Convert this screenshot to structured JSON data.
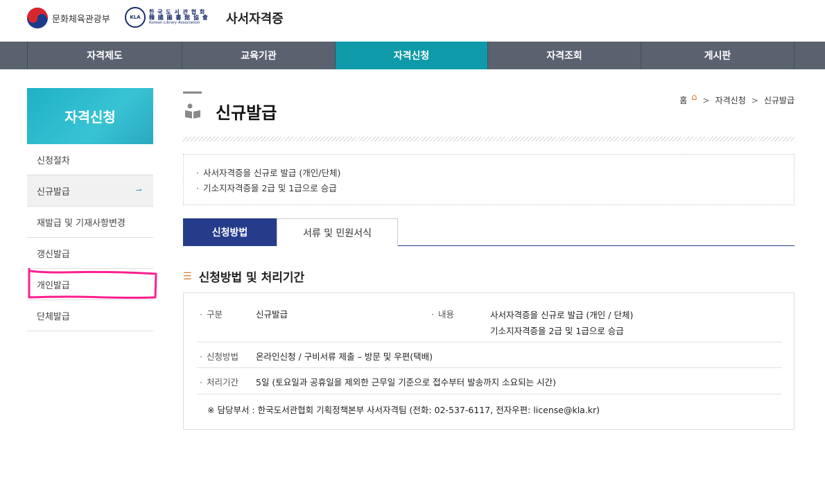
{
  "header": {
    "ministry": "문화체육관광부",
    "kla": {
      "seal": "KLA",
      "line1": "한 국 도 서 관 협 회",
      "line2": "韓 國 圖 書 館 協 會",
      "line3": "Korean Library Association"
    },
    "site_title": "사서자격증"
  },
  "gnb": {
    "items": [
      "자격제도",
      "교육기관",
      "자격신청",
      "자격조회",
      "게시판"
    ],
    "active": "자격신청"
  },
  "lnb": {
    "title": "자격신청",
    "items": [
      "신청절차",
      "신규발급",
      "재발급 및 기재사항변경",
      "갱신발급",
      "개인발급",
      "단체발급"
    ],
    "active_index": 1,
    "annotation_color": "#ff1f8e"
  },
  "page": {
    "title": "신규발급",
    "breadcrumb": {
      "home": "홈",
      "level1": "자격신청",
      "level2": "신규발급"
    },
    "summary": [
      "사서자격증을 신규로 발급 (개인/단체)",
      "기소지자격증을 2급 및 1급으로 승급"
    ],
    "tabs": [
      "신청방법",
      "서류 및 민원서식"
    ],
    "section_title": "신청방법 및 처리기간",
    "info": {
      "category_label": "구분",
      "category_value": "신규발급",
      "content_label": "내용",
      "content_line1": "사서자격증을 신규로 발급 (개인 / 단체)",
      "content_line2": "기소지자격증을 2급 및 1급으로 승급",
      "method_label": "신청방법",
      "method_value": "온라인신청 / 구비서류 제출 – 방문 및 우편(택배)",
      "period_label": "처리기간",
      "period_value": "5일 (토요일과 공휴일을 제외한 근무일 기준으로 접수부터 발송까지 소요되는 시간)",
      "contact": "※ 담당부서 : 한국도서관협회 기획정책본부 사서자격팀 (전화: 02-537-6117, 전자우편: license@kla.kr)"
    }
  },
  "colors": {
    "gnb_bg": "#5a6270",
    "gnb_active": "#0e9aa8",
    "tab_active": "#243c8a",
    "accent_orange": "#e07a2a"
  }
}
